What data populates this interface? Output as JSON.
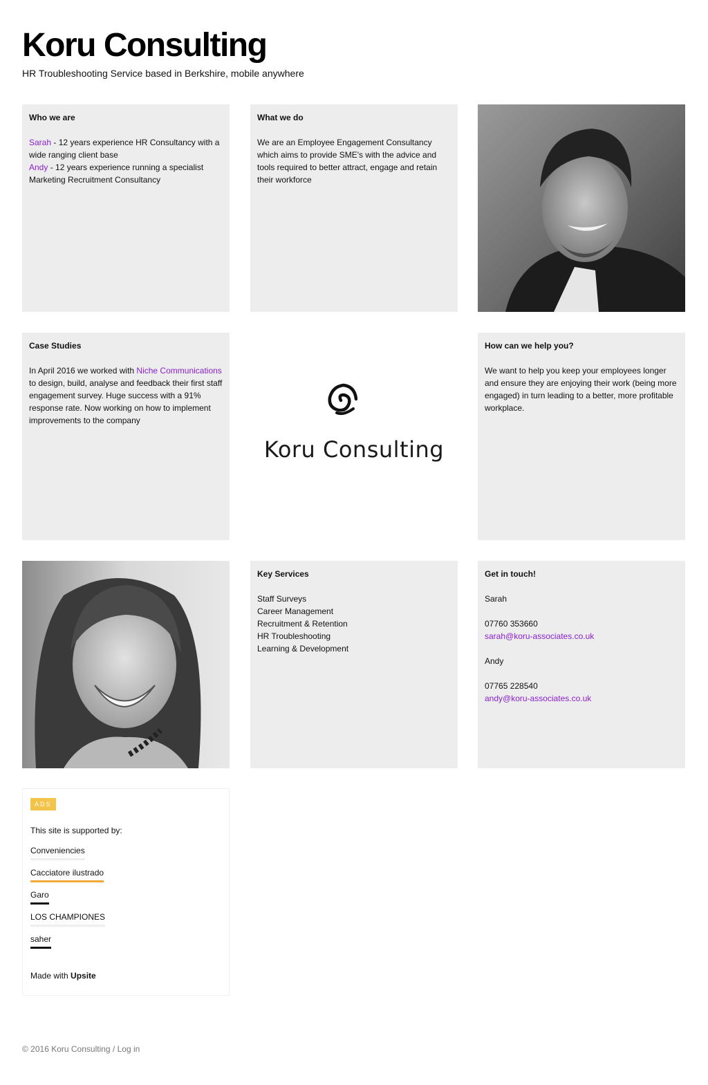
{
  "site": {
    "title": "Koru Consulting",
    "tagline": "HR Troubleshooting Service based in Berkshire, mobile anywhere"
  },
  "who": {
    "heading": "Who we are",
    "sarah_link": "Sarah",
    "sarah_text": " - 12 years experience HR Consultancy with a wide ranging client base",
    "andy_link": "Andy",
    "andy_text": " - 12 years experience running a specialist Marketing Recruitment Consultancy"
  },
  "what": {
    "heading": "What we do",
    "body": "We are an Employee Engagement Consultancy which aims to provide SME's with the advice and tools required to better attract, engage and retain their workforce"
  },
  "case": {
    "heading": "Case Studies",
    "text_before": "In April 2016 we worked with ",
    "link": "Niche Communications",
    "text_after": " to design, build, analyse and feedback their first staff engagement survey.  Huge success with a 91% response rate.  Now working on how to implement improvements to the company"
  },
  "logo": {
    "text": "Koru Consulting"
  },
  "help": {
    "heading": "How can we help you?",
    "body": "We want to help you keep your employees longer and ensure they are enjoying their work (being more engaged) in turn leading to a better, more profitable workplace."
  },
  "services": {
    "heading": "Key Services",
    "items": [
      "Staff Surveys",
      "Career Management",
      "Recruitment & Retention",
      "HR Troubleshooting",
      "Learning & Development"
    ]
  },
  "contact": {
    "heading": "Get in touch!",
    "sarah_name": "Sarah",
    "sarah_phone": "07760 353660",
    "sarah_email": "sarah@koru-associates.co.uk",
    "andy_name": "Andy",
    "andy_phone": "07765 228540",
    "andy_email": "andy@koru-associates.co.uk"
  },
  "ads": {
    "badge": "ADS",
    "intro": "This site is supported by:",
    "links": [
      {
        "label": "Conveniencies",
        "underline": "#eeeeee"
      },
      {
        "label": "Cacciatore ilustrado",
        "underline": "#f3a83a"
      },
      {
        "label": "Garo",
        "underline": "#111111"
      },
      {
        "label": "LOS CHAMPIONES",
        "underline": "#eeeeee"
      },
      {
        "label": "saher",
        "underline": "#111111"
      }
    ],
    "made_with_prefix": "Made with ",
    "made_with_brand": "Upsite"
  },
  "footer": {
    "copyright": "© 2016 Koru Consulting",
    "separator": " / ",
    "login": "Log in"
  },
  "colors": {
    "link": "#8a1fcf",
    "tile_bg": "#ededed",
    "badge": "#f3c34a"
  }
}
